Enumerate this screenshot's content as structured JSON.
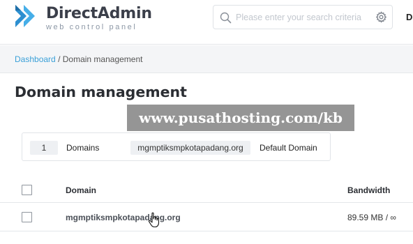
{
  "app": {
    "brand_title": "DirectAdmin",
    "brand_subtitle": "web control panel",
    "logo_icon": "directadmin-chevron-logo",
    "accent_color": "#3aa0d8",
    "user_initial": "D"
  },
  "search": {
    "placeholder": "Please enter your search criteria",
    "value": "",
    "icons": [
      "search-icon",
      "gear-icon"
    ]
  },
  "breadcrumb": {
    "link": "Dashboard",
    "separator": "/",
    "current": "Domain management"
  },
  "page": {
    "title": "Domain management"
  },
  "watermark": {
    "text": "www.pusathosting.com/kb"
  },
  "summary": {
    "count": "1",
    "count_label": "Domains",
    "default_domain": "mgmptiksmpkotapadang.org",
    "default_label": "Default Domain"
  },
  "table": {
    "columns": [
      "Domain",
      "Bandwidth"
    ],
    "rows": [
      {
        "domain": "mgmptiksmpkotapadang.org",
        "bandwidth": "89.59 MB / ∞"
      }
    ]
  }
}
